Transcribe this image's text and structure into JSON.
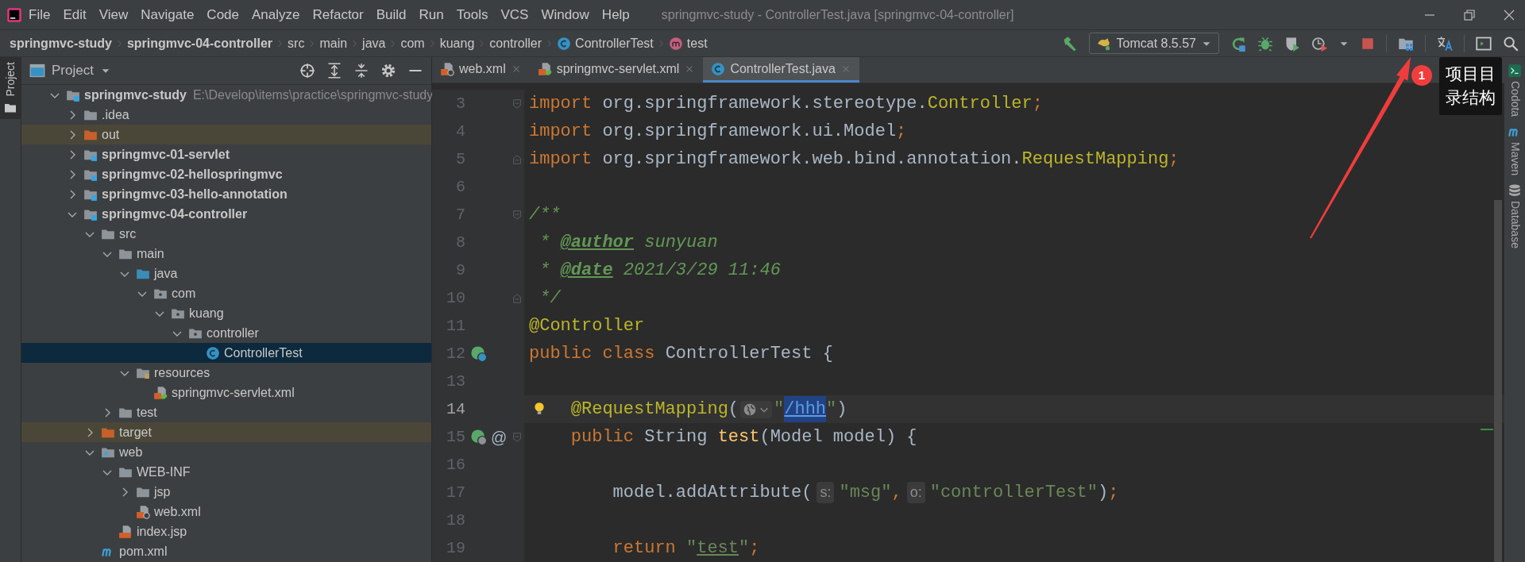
{
  "menu_bar": {
    "items": [
      "File",
      "Edit",
      "View",
      "Navigate",
      "Code",
      "Analyze",
      "Refactor",
      "Build",
      "Run",
      "Tools",
      "VCS",
      "Window",
      "Help"
    ],
    "title": "springmvc-study - ControllerTest.java [springmvc-04-controller]"
  },
  "breadcrumbs": [
    {
      "text": "springmvc-study",
      "kind": "module"
    },
    {
      "text": "springmvc-04-controller",
      "kind": "module"
    },
    {
      "text": "src",
      "kind": "folder"
    },
    {
      "text": "main",
      "kind": "folder"
    },
    {
      "text": "java",
      "kind": "folder"
    },
    {
      "text": "com",
      "kind": "folder"
    },
    {
      "text": "kuang",
      "kind": "folder"
    },
    {
      "text": "controller",
      "kind": "folder"
    },
    {
      "text": "ControllerTest",
      "kind": "class"
    },
    {
      "text": "test",
      "kind": "method"
    }
  ],
  "toolbar": {
    "run_config": "Tomcat 8.5.57"
  },
  "left_strip": {
    "tab": "Project"
  },
  "project_panel": {
    "title": "Project",
    "tree": [
      {
        "label": "springmvc-study",
        "kind": "module",
        "path": "E:\\Develop\\items\\practice\\springmvc-study",
        "expanded": true,
        "selected": false,
        "children": [
          {
            "label": ".idea",
            "kind": "folder",
            "expanded": false,
            "selected": false
          },
          {
            "label": "out",
            "kind": "excluded",
            "expanded": false,
            "selected": false
          },
          {
            "label": "springmvc-01-servlet",
            "kind": "module",
            "expanded": false,
            "selected": false
          },
          {
            "label": "springmvc-02-hellospringmvc",
            "kind": "module",
            "expanded": false,
            "selected": false
          },
          {
            "label": "springmvc-03-hello-annotation",
            "kind": "module",
            "expanded": false,
            "selected": false
          },
          {
            "label": "springmvc-04-controller",
            "kind": "module",
            "expanded": true,
            "selected": false,
            "children": [
              {
                "label": "src",
                "kind": "folder",
                "expanded": true,
                "selected": false,
                "children": [
                  {
                    "label": "main",
                    "kind": "folder",
                    "expanded": true,
                    "selected": false,
                    "children": [
                      {
                        "label": "java",
                        "kind": "source",
                        "expanded": true,
                        "selected": false,
                        "children": [
                          {
                            "label": "com",
                            "kind": "package",
                            "expanded": true,
                            "selected": false,
                            "children": [
                              {
                                "label": "kuang",
                                "kind": "package",
                                "expanded": true,
                                "selected": false,
                                "children": [
                                  {
                                    "label": "controller",
                                    "kind": "package",
                                    "expanded": true,
                                    "selected": false,
                                    "children": [
                                      {
                                        "label": "ControllerTest",
                                        "kind": "class",
                                        "selected": true
                                      }
                                    ]
                                  }
                                ]
                              }
                            ]
                          }
                        ]
                      },
                      {
                        "label": "resources",
                        "kind": "resources",
                        "expanded": true,
                        "selected": false,
                        "children": [
                          {
                            "label": "springmvc-servlet.xml",
                            "kind": "spring-xml",
                            "selected": false
                          }
                        ]
                      }
                    ]
                  },
                  {
                    "label": "test",
                    "kind": "folder",
                    "expanded": false,
                    "selected": false
                  }
                ]
              },
              {
                "label": "target",
                "kind": "excluded",
                "expanded": false,
                "selected": false
              },
              {
                "label": "web",
                "kind": "web",
                "expanded": true,
                "selected": false,
                "children": [
                  {
                    "label": "WEB-INF",
                    "kind": "folder",
                    "expanded": true,
                    "selected": false,
                    "children": [
                      {
                        "label": "jsp",
                        "kind": "folder",
                        "expanded": false,
                        "selected": false
                      },
                      {
                        "label": "web.xml",
                        "kind": "web-xml",
                        "selected": false
                      }
                    ]
                  },
                  {
                    "label": "index.jsp",
                    "kind": "jsp",
                    "selected": false
                  }
                ]
              },
              {
                "label": "pom.xml",
                "kind": "maven",
                "selected": false
              }
            ]
          }
        ]
      }
    ]
  },
  "editor_tabs": [
    {
      "label": "web.xml",
      "kind": "web-xml",
      "selected": false
    },
    {
      "label": "springmvc-servlet.xml",
      "kind": "spring-xml",
      "selected": false
    },
    {
      "label": "ControllerTest.java",
      "kind": "class",
      "selected": true
    }
  ],
  "editor": {
    "lines": [
      {
        "number": "3",
        "fold_marker": {
          "kind": "open"
        },
        "tokens": [
          {
            "text": "import",
            "kind": "keyword"
          },
          {
            "text": " org.springframework.stereotype.",
            "kind": "plain"
          },
          {
            "text": "Controller",
            "kind": "type"
          },
          {
            "text": ";",
            "kind": "keyword"
          }
        ]
      },
      {
        "number": "4",
        "tokens": [
          {
            "text": "import",
            "kind": "keyword"
          },
          {
            "text": " org.springframework.ui.Model",
            "kind": "plain"
          },
          {
            "text": ";",
            "kind": "keyword"
          }
        ]
      },
      {
        "number": "5",
        "fold_marker": {
          "kind": "close"
        },
        "tokens": [
          {
            "text": "import",
            "kind": "keyword"
          },
          {
            "text": " org.springframework.web.bind.annotation.",
            "kind": "plain"
          },
          {
            "text": "RequestMapping",
            "kind": "type"
          },
          {
            "text": ";",
            "kind": "keyword"
          }
        ]
      },
      {
        "number": "6"
      },
      {
        "number": "7",
        "fold_marker": {
          "kind": "open"
        },
        "tokens": [
          {
            "text": "/**",
            "kind": "doc"
          }
        ]
      },
      {
        "number": "8",
        "tokens": [
          {
            "text": " * ",
            "kind": "doc"
          },
          {
            "text": "@author",
            "kind": "doctag"
          },
          {
            "text": " sunyuan",
            "kind": "doc"
          }
        ]
      },
      {
        "number": "9",
        "tokens": [
          {
            "text": " * ",
            "kind": "doc"
          },
          {
            "text": "@date",
            "kind": "doctag"
          },
          {
            "text": " 2021/3/29 11:46",
            "kind": "doc"
          }
        ]
      },
      {
        "number": "10",
        "fold_marker": {
          "kind": "close"
        },
        "tokens": [
          {
            "text": " */",
            "kind": "doc"
          }
        ]
      },
      {
        "number": "11",
        "tokens": [
          {
            "text": "@Controller",
            "kind": "annotation"
          }
        ]
      },
      {
        "number": "12",
        "gutter_icons": [
          {
            "kind": "bean"
          }
        ],
        "tokens": [
          {
            "text": "public class",
            "kind": "keyword"
          },
          {
            "text": " ControllerTest {",
            "kind": "plain"
          }
        ]
      },
      {
        "number": "13"
      },
      {
        "number": "14",
        "current": true,
        "intention": true,
        "indent": {
          "kind": "member"
        },
        "tokens": [
          {
            "text": "@RequestMapping",
            "kind": "annotation"
          },
          {
            "text": "(",
            "kind": "plain"
          },
          {
            "kind": "url-hint"
          },
          {
            "text": "\"",
            "kind": "string"
          },
          {
            "text": "/hhh",
            "kind": "url"
          },
          {
            "text": "\"",
            "kind": "string"
          },
          {
            "text": ")",
            "kind": "plain"
          }
        ]
      },
      {
        "number": "15",
        "fold_marker": {
          "kind": "open"
        },
        "gutter_icons": [
          {
            "kind": "bean-web"
          }
        ],
        "gutter_text": "@",
        "indent": {
          "kind": "member"
        },
        "tokens": [
          {
            "text": "public",
            "kind": "keyword"
          },
          {
            "text": " String ",
            "kind": "plain"
          },
          {
            "text": "test",
            "kind": "function"
          },
          {
            "text": "(Model model) {",
            "kind": "plain"
          }
        ]
      },
      {
        "number": "16"
      },
      {
        "number": "17",
        "indent": {
          "kind": "body"
        },
        "tokens": [
          {
            "text": "model.addAttribute(",
            "kind": "plain"
          },
          {
            "text": "s:",
            "kind": "hint"
          },
          {
            "text": "\"msg\"",
            "kind": "string"
          },
          {
            "text": ",",
            "kind": "keyword"
          },
          {
            "text": "o:",
            "kind": "hint"
          },
          {
            "text": "\"controllerTest\"",
            "kind": "string"
          },
          {
            "text": ")",
            "kind": "plain"
          },
          {
            "text": ";",
            "kind": "keyword"
          }
        ]
      },
      {
        "number": "18"
      },
      {
        "number": "19",
        "indent": {
          "kind": "body"
        },
        "tokens": [
          {
            "text": "return",
            "kind": "keyword"
          },
          {
            "text": " \"",
            "kind": "string"
          },
          {
            "text": "test",
            "kind": "string-ref"
          },
          {
            "text": "\"",
            "kind": "string"
          },
          {
            "text": ";",
            "kind": "keyword"
          }
        ]
      }
    ]
  },
  "annotation": {
    "badge": "1",
    "tooltip": "项目目录结构"
  },
  "right_strip": {
    "tabs": [
      {
        "label": "Codota",
        "kind": "codota"
      },
      {
        "label": "Maven",
        "kind": "maven"
      },
      {
        "label": "Database",
        "kind": "database"
      }
    ]
  }
}
